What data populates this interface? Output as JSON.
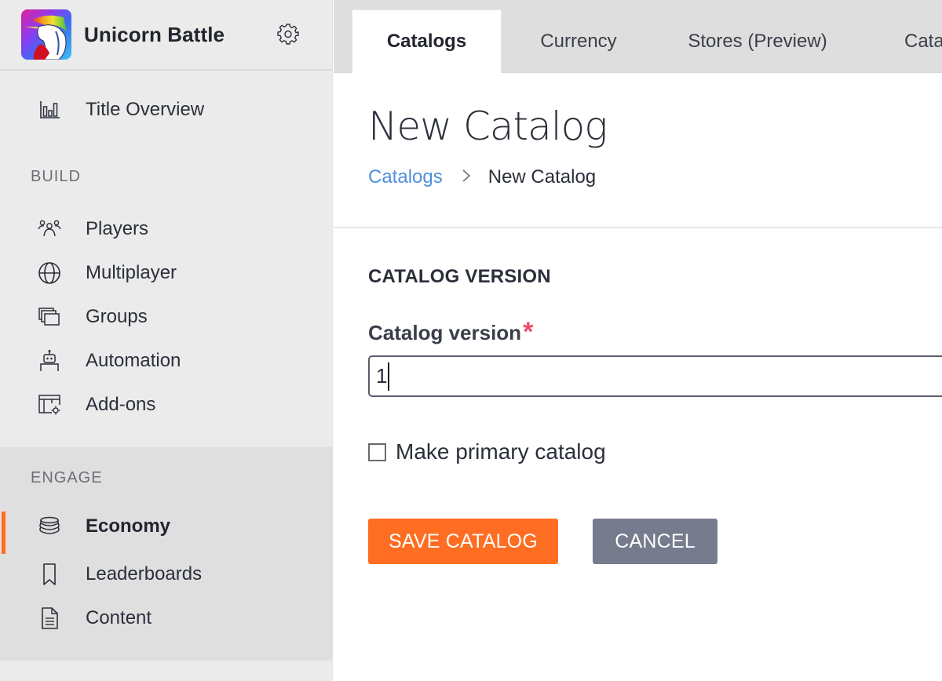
{
  "app": {
    "title": "Unicorn Battle",
    "logo_icon": "unicorn-logo",
    "settings_icon": "gear-icon"
  },
  "sidebar": {
    "overview": {
      "label": "Title Overview",
      "icon": "bar-chart-icon"
    },
    "sections": [
      {
        "label": "BUILD",
        "items": [
          {
            "label": "Players",
            "icon": "players-icon"
          },
          {
            "label": "Multiplayer",
            "icon": "globe-icon"
          },
          {
            "label": "Groups",
            "icon": "groups-icon"
          },
          {
            "label": "Automation",
            "icon": "robot-icon"
          },
          {
            "label": "Add-ons",
            "icon": "addons-icon"
          }
        ]
      },
      {
        "label": "ENGAGE",
        "items": [
          {
            "label": "Economy",
            "icon": "coins-icon",
            "active": true
          },
          {
            "label": "Leaderboards",
            "icon": "bookmark-icon"
          },
          {
            "label": "Content",
            "icon": "document-icon"
          }
        ]
      }
    ]
  },
  "tabs": [
    {
      "label": "Catalogs",
      "active": true
    },
    {
      "label": "Currency"
    },
    {
      "label": "Stores (Preview)"
    },
    {
      "label": "Cata"
    }
  ],
  "page": {
    "title": "New Catalog",
    "breadcrumb": {
      "parent": "Catalogs",
      "separator": ">",
      "current": "New Catalog"
    }
  },
  "form": {
    "section_heading": "CATALOG VERSION",
    "version_label": "Catalog version",
    "required_marker": "*",
    "version_value": "1",
    "primary_checkbox": {
      "label": "Make primary catalog",
      "checked": false
    },
    "save_label": "SAVE CATALOG",
    "cancel_label": "CANCEL"
  },
  "colors": {
    "accent": "#ff6d22",
    "cancel": "#767b8d",
    "link": "#4f8fdc",
    "required": "#f04a6b"
  }
}
